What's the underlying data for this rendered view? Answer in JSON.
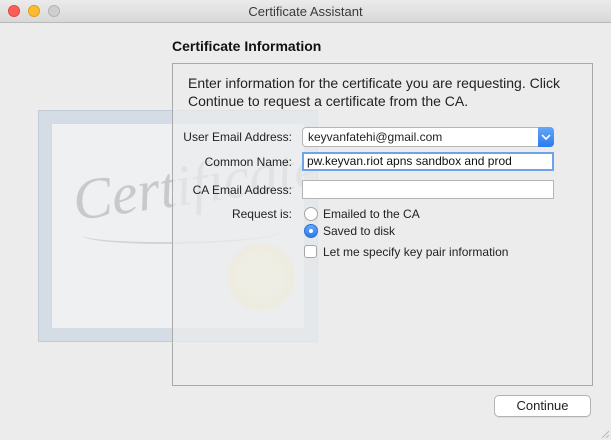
{
  "window": {
    "title": "Certificate Assistant"
  },
  "section": {
    "title": "Certificate Information"
  },
  "intro": "Enter information for the certificate you are requesting. Click Continue to request a certificate from the CA.",
  "decoration": {
    "certificate_script": "Certificate"
  },
  "form": {
    "user_email": {
      "label": "User Email Address:",
      "value": "keyvanfatehi@gmail.com"
    },
    "common_name": {
      "label": "Common Name:",
      "value": "pw.keyvan.riot apns sandbox and prod"
    },
    "ca_email": {
      "label": "CA Email Address:",
      "value": ""
    },
    "request": {
      "label": "Request is:",
      "options": [
        {
          "label": "Emailed to the CA",
          "selected": false
        },
        {
          "label": "Saved to disk",
          "selected": true
        }
      ]
    },
    "key_pair": {
      "label": "Let me specify key pair information",
      "checked": false
    }
  },
  "buttons": {
    "continue": "Continue"
  },
  "colors": {
    "accent": "#2c7af0",
    "focus_ring": "#6ea3e8",
    "close": "#fc5f57",
    "minimize": "#fdbc2e"
  }
}
